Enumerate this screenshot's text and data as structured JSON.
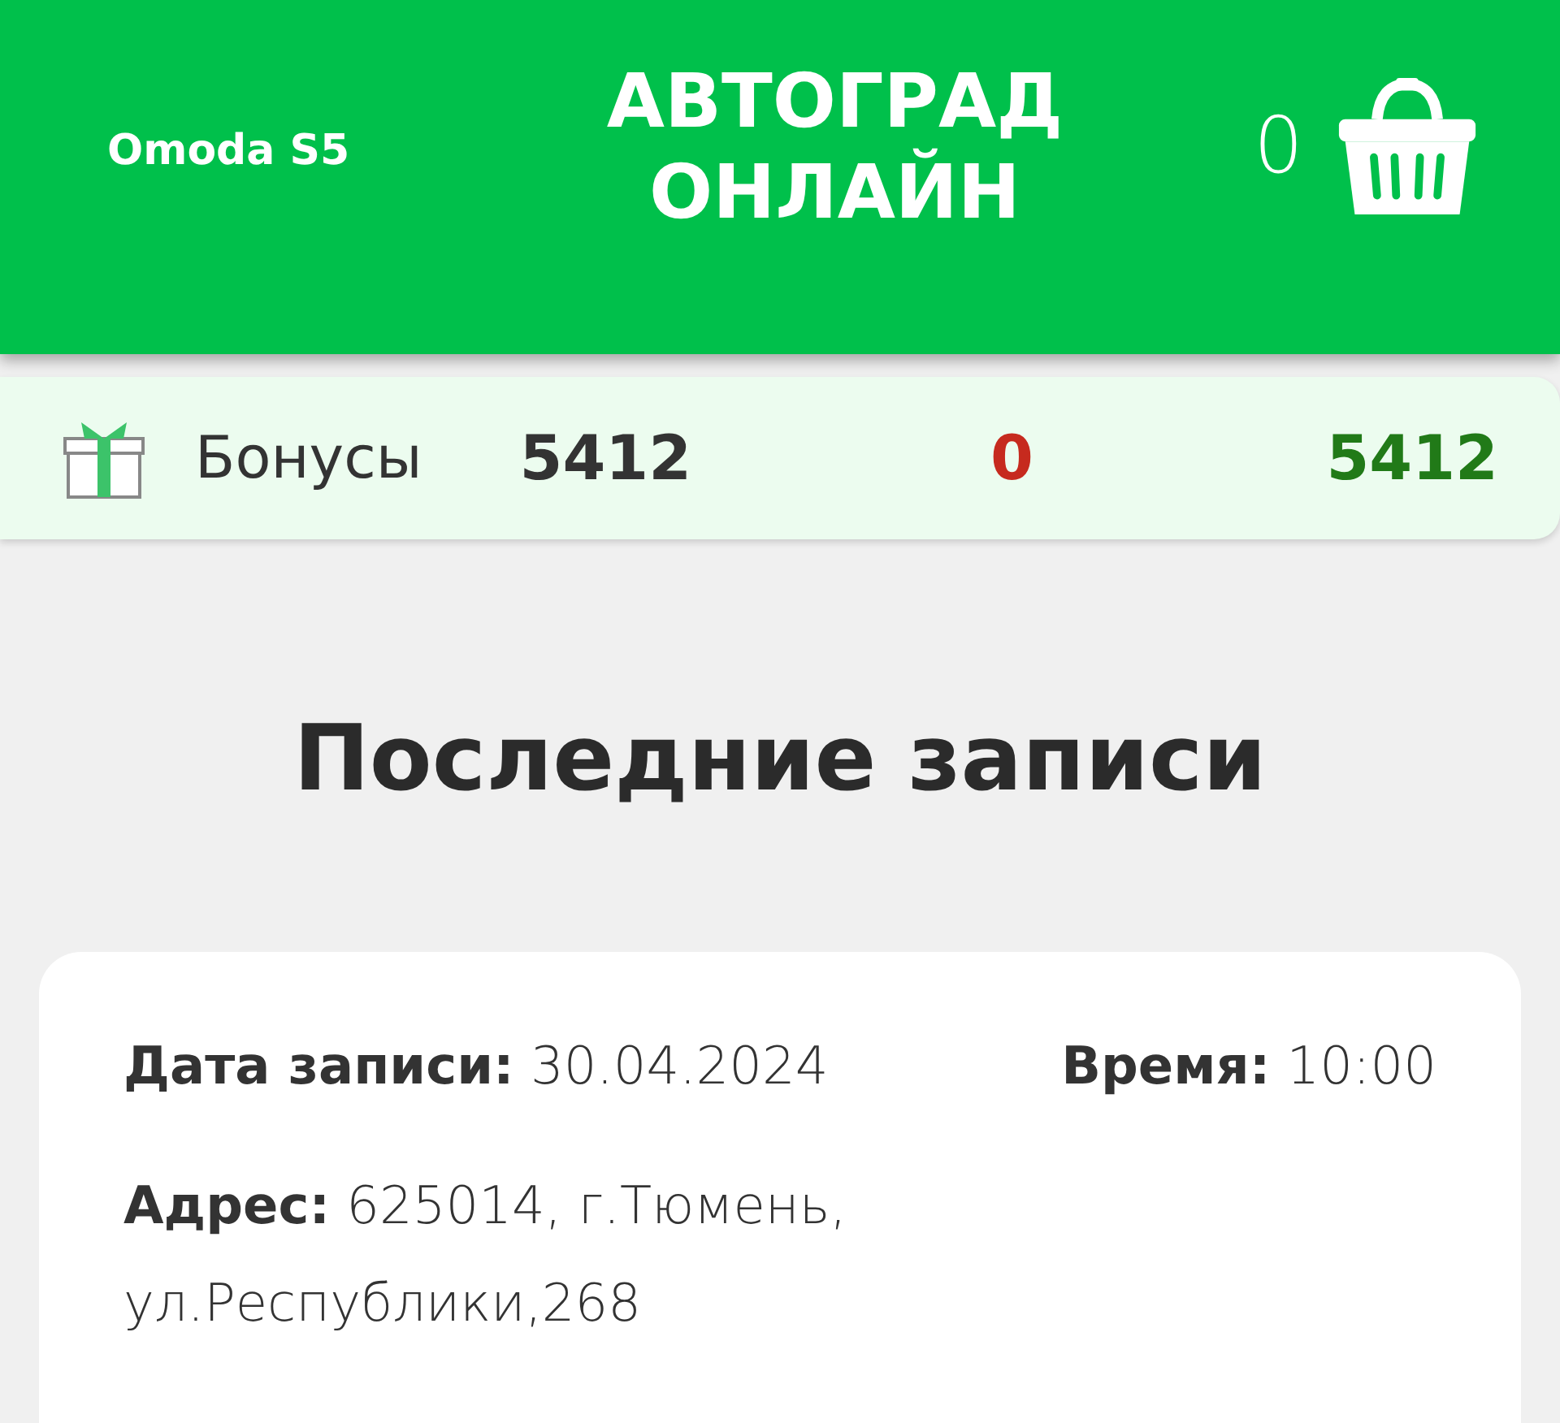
{
  "header": {
    "model": "Omoda S5",
    "title": "АВТОГРАД ОНЛАЙН",
    "cart_count": "0"
  },
  "bonuses": {
    "label": "Бонусы",
    "total": "5412",
    "spent": "0",
    "available": "5412"
  },
  "section_title": "Последние записи",
  "records": [
    {
      "date": "**Дата записи:** 30.04.2024",
      "time": "**Время:** 10:00",
      "address": "**Адрес:** 625014, г.Тюмень, ул.Республики,268"
    }
  ]
}
